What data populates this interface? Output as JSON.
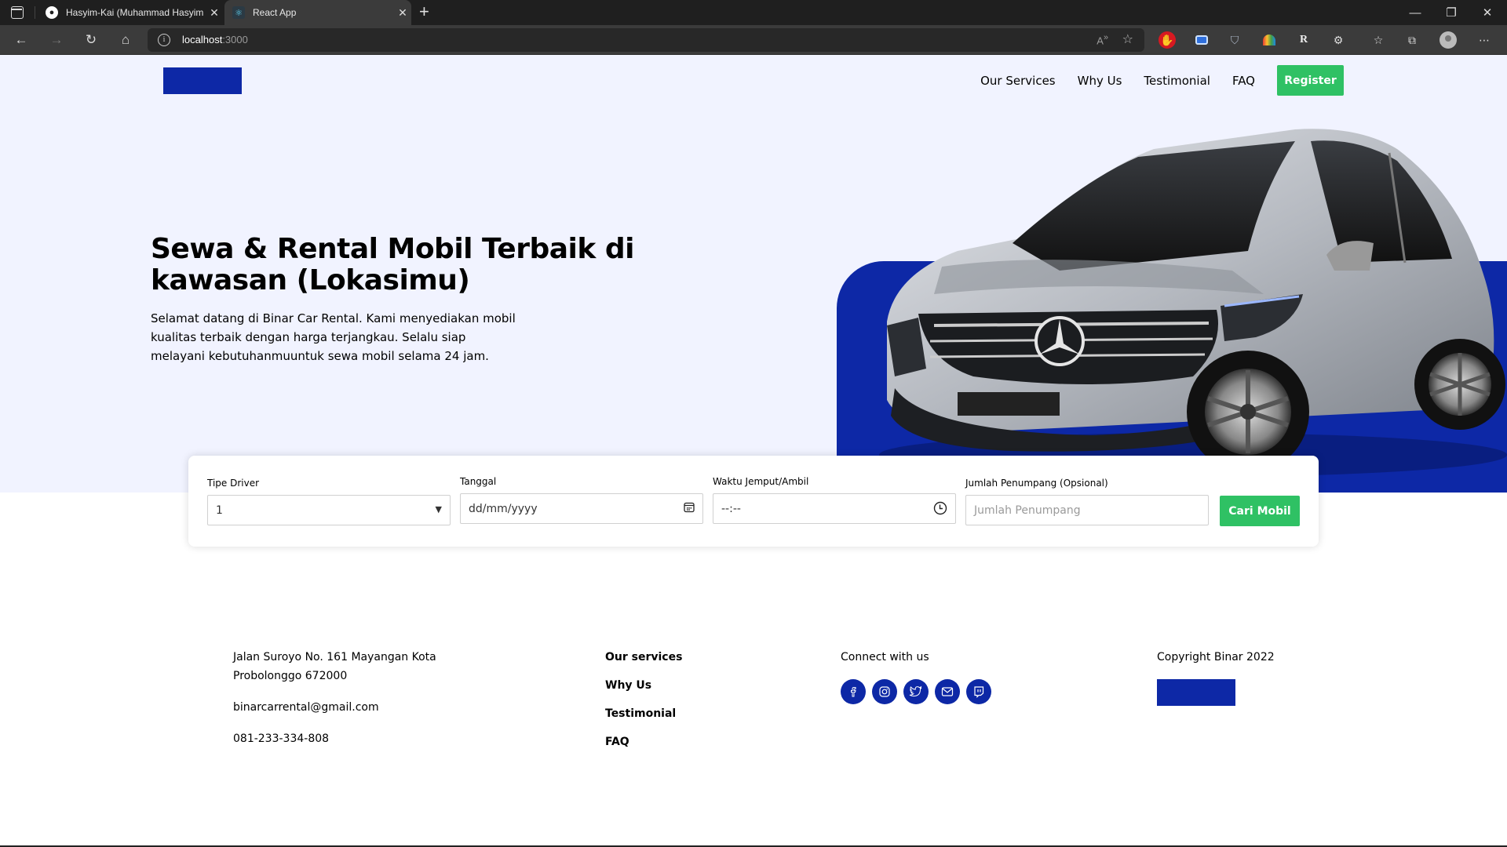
{
  "browser": {
    "tabs": [
      {
        "title": "Hasyim-Kai (Muhammad Hasyim",
        "icon": "github-icon",
        "active": false
      },
      {
        "title": "React App",
        "icon": "react-icon",
        "active": true
      }
    ],
    "new_tab": "+",
    "url_host": "localhost",
    "url_port": ":3000",
    "window_controls": {
      "minimize": "—",
      "restore": "❐",
      "close": "✕"
    },
    "nav_icons": {
      "back": "←",
      "forward": "→",
      "reload": "↻",
      "home": "⌂"
    },
    "read_aloud": "Ȃ",
    "extensions_menu": "⋯"
  },
  "header": {
    "nav": [
      "Our Services",
      "Why Us",
      "Testimonial",
      "FAQ"
    ],
    "register_label": "Register"
  },
  "hero": {
    "title": "Sewa & Rental Mobil Terbaik di kawasan (Lokasimu)",
    "description": "Selamat datang di Binar Car Rental. Kami menyediakan mobil kualitas terbaik dengan harga terjangkau. Selalu siap melayani kebutuhanmuuntuk sewa mobil selama 24 jam."
  },
  "search": {
    "driver_label": "Tipe Driver",
    "driver_value": "1",
    "date_label": "Tanggal",
    "date_placeholder": "dd/mm/yyyy",
    "time_label": "Waktu Jemput/Ambil",
    "time_placeholder": "--:--",
    "passenger_label": "Jumlah Penumpang (Opsional)",
    "passenger_placeholder": "Jumlah Penumpang",
    "submit_label": "Cari Mobil"
  },
  "footer": {
    "address": "Jalan Suroyo No. 161 Mayangan Kota Probolonggo 672000",
    "email": "binarcarrental@gmail.com",
    "phone": "081-233-334-808",
    "links": [
      "Our services",
      "Why Us",
      "Testimonial",
      "FAQ"
    ],
    "connect_label": "Connect with us",
    "socials": [
      "facebook",
      "instagram",
      "twitter",
      "mail",
      "twitch"
    ],
    "copyright": "Copyright Binar 2022"
  },
  "colors": {
    "brand_blue": "#0D28A6",
    "accent_green": "#2FC164",
    "hero_bg": "#F1F3FF"
  }
}
